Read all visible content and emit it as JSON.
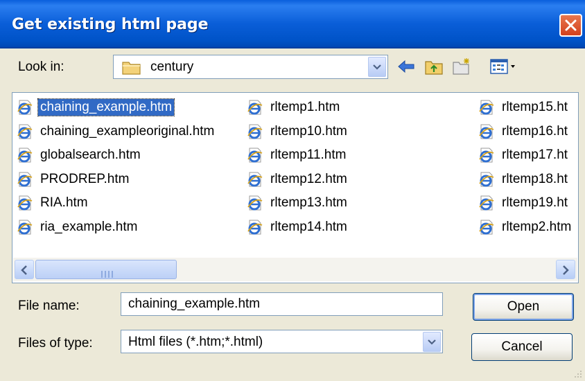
{
  "window": {
    "title": "Get existing html page"
  },
  "look_in": {
    "label": "Look in:",
    "value": "century"
  },
  "files": {
    "column1": [
      "chaining_example.htm",
      "chaining_exampleoriginal.htm",
      "globalsearch.htm",
      "PRODREP.htm",
      "RIA.htm",
      "ria_example.htm"
    ],
    "column2": [
      "rltemp1.htm",
      "rltemp10.htm",
      "rltemp11.htm",
      "rltemp12.htm",
      "rltemp13.htm",
      "rltemp14.htm"
    ],
    "column3": [
      "rltemp15.ht",
      "rltemp16.ht",
      "rltemp17.ht",
      "rltemp18.ht",
      "rltemp19.ht",
      "rltemp2.htm"
    ],
    "selected": "chaining_example.htm"
  },
  "file_name": {
    "label": "File name:",
    "value": "chaining_example.htm"
  },
  "file_type": {
    "label": "Files of type:",
    "value": "Html files (*.htm;*.html)"
  },
  "buttons": {
    "open": "Open",
    "cancel": "Cancel"
  },
  "colors": {
    "titlebar": "#0a5ed8",
    "selection": "#316ac5",
    "dialog_bg": "#ece9d8"
  }
}
